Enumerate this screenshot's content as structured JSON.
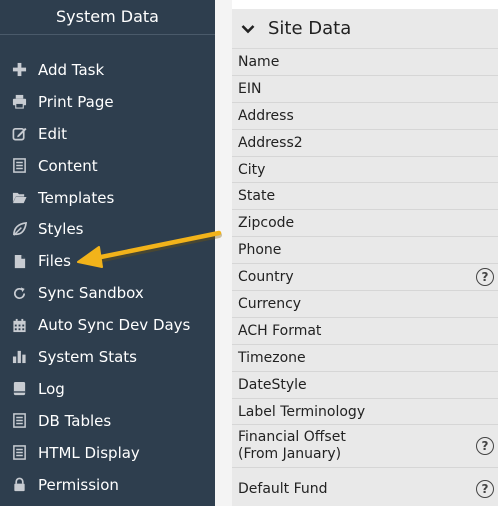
{
  "sidebar": {
    "title": "System Data",
    "items": [
      {
        "label": "Add Task",
        "icon": "plus-icon"
      },
      {
        "label": "Print Page",
        "icon": "printer-icon"
      },
      {
        "label": "Edit",
        "icon": "edit-icon"
      },
      {
        "label": "Content",
        "icon": "document-list-icon"
      },
      {
        "label": "Templates",
        "icon": "folder-open-icon"
      },
      {
        "label": "Styles",
        "icon": "leaf-icon"
      },
      {
        "label": "Files",
        "icon": "file-icon"
      },
      {
        "label": "Sync Sandbox",
        "icon": "refresh-icon"
      },
      {
        "label": "Auto Sync Dev Days",
        "icon": "calendar-icon"
      },
      {
        "label": "System Stats",
        "icon": "bar-chart-icon"
      },
      {
        "label": "Log",
        "icon": "book-icon"
      },
      {
        "label": "DB Tables",
        "icon": "document-list-icon"
      },
      {
        "label": "HTML Display",
        "icon": "document-list-icon"
      },
      {
        "label": "Permission",
        "icon": "lock-icon"
      }
    ]
  },
  "panel": {
    "title": "Site Data",
    "rows": [
      {
        "label": "Name",
        "help": false
      },
      {
        "label": "EIN",
        "help": false
      },
      {
        "label": "Address",
        "help": false
      },
      {
        "label": "Address2",
        "help": false
      },
      {
        "label": "City",
        "help": false
      },
      {
        "label": "State",
        "help": false
      },
      {
        "label": "Zipcode",
        "help": false
      },
      {
        "label": "Phone",
        "help": false
      },
      {
        "label": "Country",
        "help": true
      },
      {
        "label": "Currency",
        "help": false
      },
      {
        "label": "ACH Format",
        "help": false
      },
      {
        "label": "Timezone",
        "help": false
      },
      {
        "label": "DateStyle",
        "help": false
      },
      {
        "label": "Label Terminology",
        "help": false
      },
      {
        "label": "Financial Offset\n(From January)",
        "help": true
      },
      {
        "label": "Default Fund",
        "help": true
      }
    ],
    "help_symbol": "?"
  },
  "annotation": {
    "color": "#f2b31a",
    "points_to": "Files"
  },
  "colors": {
    "sidebar_bg": "#2e3e4e",
    "panel_bg": "#e9e9e9"
  }
}
